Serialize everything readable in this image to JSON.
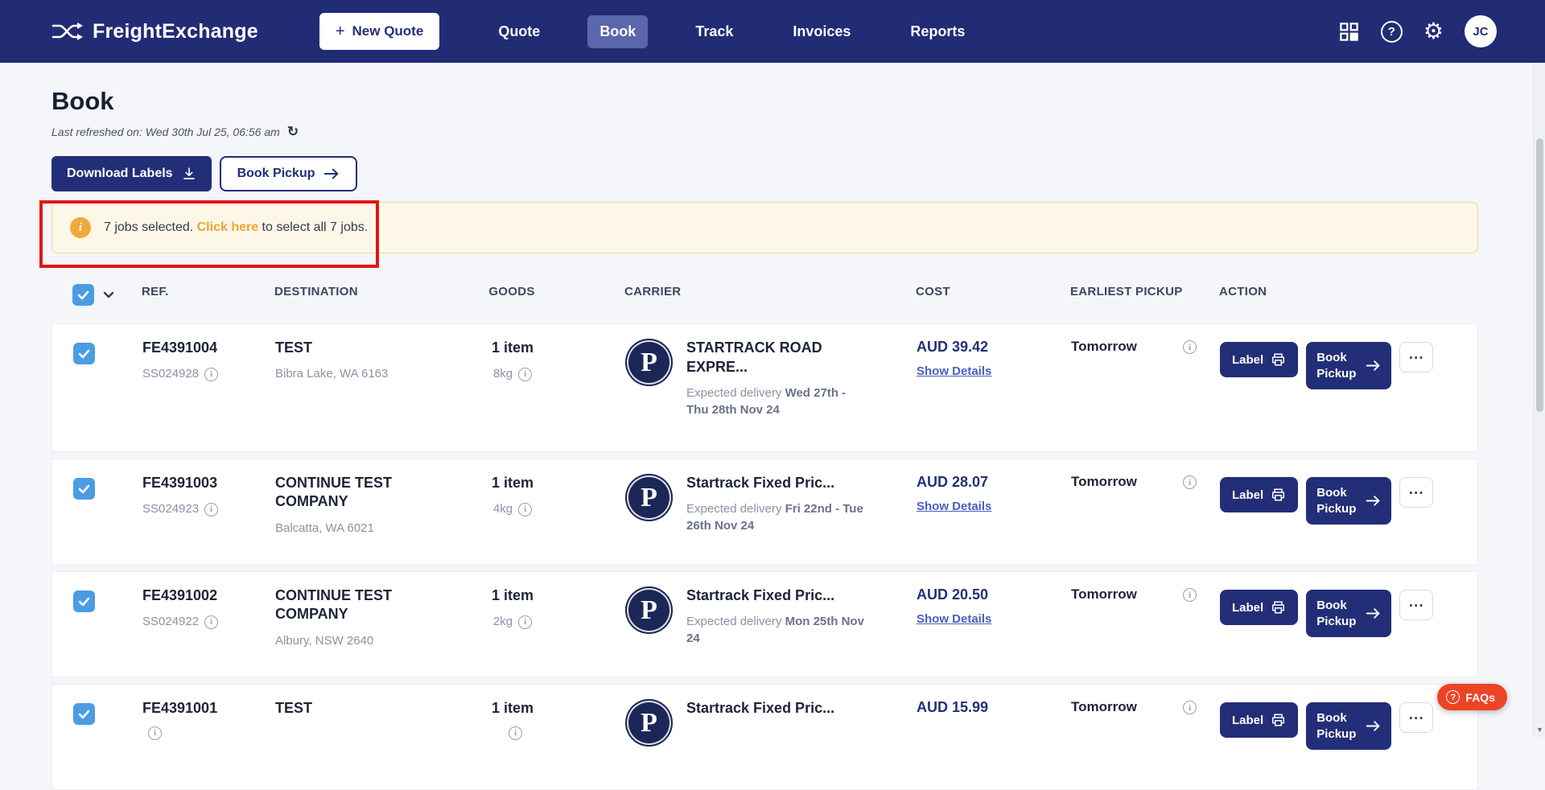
{
  "navbar": {
    "brand": "FreightExchange",
    "new_quote_label": "New Quote",
    "items": [
      {
        "label": "Quote",
        "active": false
      },
      {
        "label": "Book",
        "active": true
      },
      {
        "label": "Track",
        "active": false
      },
      {
        "label": "Invoices",
        "active": false
      },
      {
        "label": "Reports",
        "active": false
      }
    ],
    "avatar_initials": "JC"
  },
  "page": {
    "title": "Book",
    "last_refreshed": "Last refreshed on: Wed 30th Jul 25, 06:56 am",
    "download_labels_label": "Download Labels",
    "book_pickup_label": "Book Pickup"
  },
  "alert": {
    "prefix": "7 jobs selected. ",
    "link": "Click here",
    "suffix": " to select all 7 jobs."
  },
  "table": {
    "headers": [
      "REF.",
      "DESTINATION",
      "GOODS",
      "CARRIER",
      "COST",
      "EARLIEST PICKUP",
      "ACTION"
    ],
    "rows": [
      {
        "ref": "FE4391004",
        "ref_sub": "SS024928",
        "dest_name": "TEST",
        "dest_addr": "Bibra Lake, WA 6163",
        "goods_items": "1 item",
        "goods_weight": "8kg",
        "carrier_name": "STARTRACK ROAD EXPRE...",
        "delivery_prefix": "Expected delivery ",
        "delivery_dates": "Wed 27th - Thu 28th Nov 24",
        "cost": "AUD 39.42",
        "details_label": "Show Details",
        "pickup": "Tomorrow",
        "label_btn": "Label",
        "book_btn": "Book Pickup"
      },
      {
        "ref": "FE4391003",
        "ref_sub": "SS024923",
        "dest_name": "CONTINUE TEST COMPANY",
        "dest_addr": "Balcatta, WA 6021",
        "goods_items": "1 item",
        "goods_weight": "4kg",
        "carrier_name": "Startrack Fixed Pric...",
        "delivery_prefix": "Expected delivery ",
        "delivery_dates": "Fri 22nd - Tue 26th Nov 24",
        "cost": "AUD 28.07",
        "details_label": "Show Details",
        "pickup": "Tomorrow",
        "label_btn": "Label",
        "book_btn": "Book Pickup"
      },
      {
        "ref": "FE4391002",
        "ref_sub": "SS024922",
        "dest_name": "CONTINUE TEST COMPANY",
        "dest_addr": "Albury, NSW 2640",
        "goods_items": "1 item",
        "goods_weight": "2kg",
        "carrier_name": "Startrack Fixed Pric...",
        "delivery_prefix": "Expected delivery ",
        "delivery_dates": "Mon 25th Nov 24",
        "cost": "AUD 20.50",
        "details_label": "Show Details",
        "pickup": "Tomorrow",
        "label_btn": "Label",
        "book_btn": "Book Pickup"
      },
      {
        "ref": "FE4391001",
        "ref_sub": "",
        "dest_name": "TEST",
        "dest_addr": "",
        "goods_items": "1 item",
        "goods_weight": "",
        "carrier_name": "Startrack Fixed Pric...",
        "delivery_prefix": "",
        "delivery_dates": "",
        "cost": "AUD 15.99",
        "details_label": "",
        "pickup": "Tomorrow",
        "label_btn": "Label",
        "book_btn": "Book Pickup"
      }
    ]
  },
  "faq": {
    "label": "FAQs"
  },
  "icons": {
    "plus": "+",
    "info": "i",
    "question": "?",
    "gear": "⚙",
    "refresh": "↻",
    "more": "...",
    "scroll_down": "▼",
    "carrier_logo_letter": "P"
  },
  "colors": {
    "navbar": "#212c74",
    "accent": "#232e78",
    "alert_bg": "#fdf7e8",
    "alert_border": "#eed9a6",
    "alert_icon_orange": "#f0a93c",
    "annotation_red": "#e31515",
    "faq_red": "#ee4426",
    "checkbox_blue": "#4b9ce3",
    "link_blue": "#4a5fc0"
  }
}
